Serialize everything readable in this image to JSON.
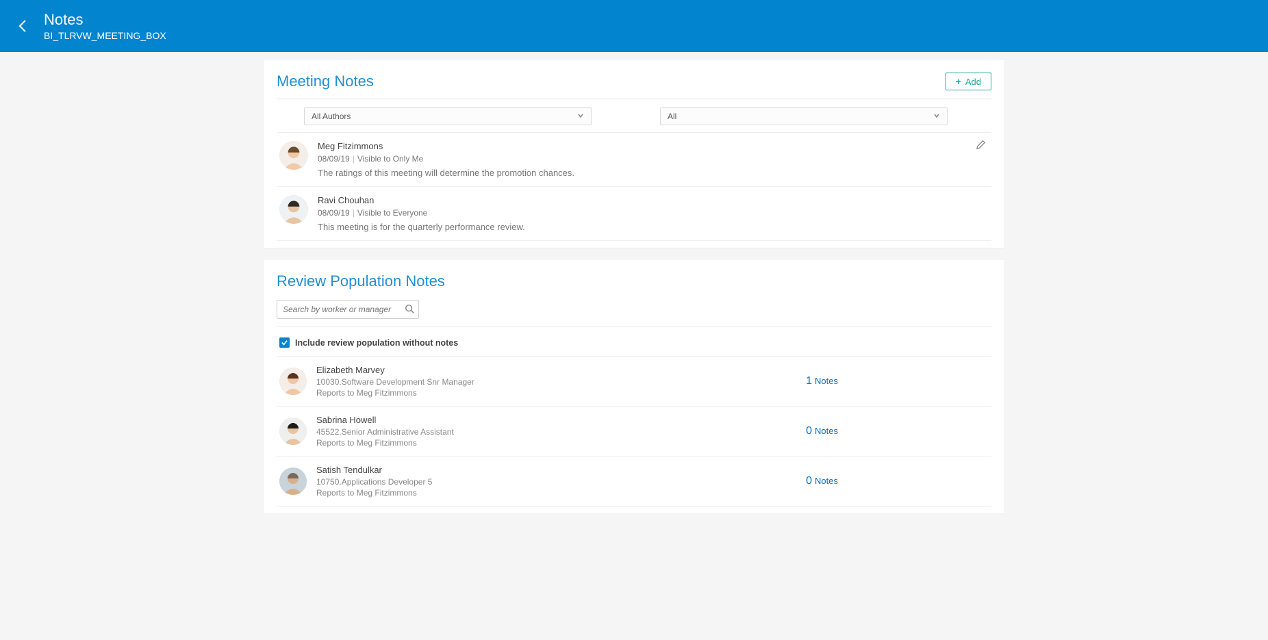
{
  "header": {
    "title": "Notes",
    "subtitle": "BI_TLRVW_MEETING_BOX"
  },
  "meetingNotes": {
    "title": "Meeting Notes",
    "addLabel": "Add",
    "filterAuthor": "All Authors",
    "filterVisibility": "All",
    "notes": [
      {
        "author": "Meg Fitzimmons",
        "date": "08/09/19",
        "visibility": "Visible to Only Me",
        "text": "The ratings of this meeting will determine the promotion chances.",
        "editable": true
      },
      {
        "author": "Ravi Chouhan",
        "date": "08/09/19",
        "visibility": "Visible to Everyone",
        "text": "This meeting is for the quarterly performance review.",
        "editable": false
      }
    ]
  },
  "reviewPopulation": {
    "title": "Review Population Notes",
    "searchPlaceholder": "Search by worker or manager",
    "includeLabel": "Include review population without notes",
    "includeChecked": true,
    "people": [
      {
        "name": "Elizabeth Marvey",
        "role": "10030.Software Development Snr Manager",
        "reports": "Reports to Meg Fitzimmons",
        "notesCount": 1,
        "notesLabel": "Notes"
      },
      {
        "name": "Sabrina Howell",
        "role": "45522.Senior Administrative Assistant",
        "reports": "Reports to Meg Fitzimmons",
        "notesCount": 0,
        "notesLabel": "Notes"
      },
      {
        "name": "Satish Tendulkar",
        "role": "10750.Applications Developer 5",
        "reports": "Reports to Meg Fitzimmons",
        "notesCount": 0,
        "notesLabel": "Notes"
      }
    ]
  }
}
